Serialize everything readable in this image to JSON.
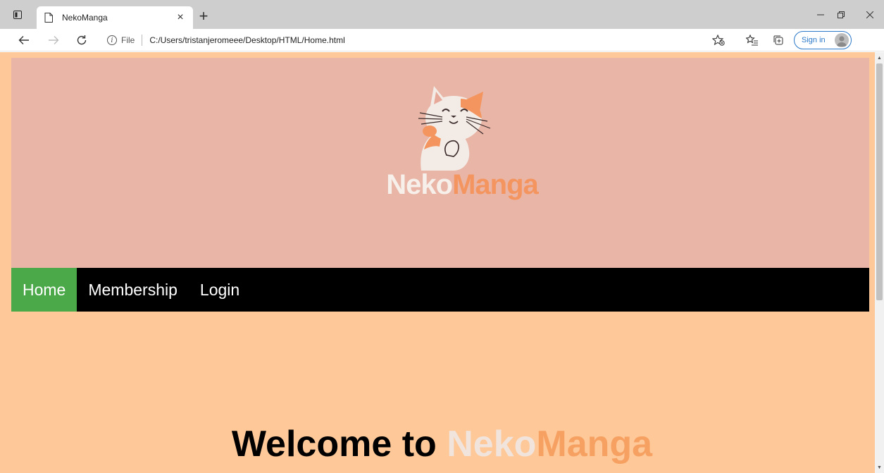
{
  "browser": {
    "tab_title": "NekoManga",
    "tab_close": "×",
    "new_tab": "+",
    "address_scheme": "File",
    "address_url": "C:/Users/tristanjeromeee/Desktop/HTML/Home.html",
    "signin_label": "Sign in",
    "more_label": "···",
    "icons": {
      "tab_actions": "tab-actions-icon",
      "page": "page-icon",
      "back": "back-arrow-icon",
      "forward": "forward-arrow-icon",
      "refresh": "refresh-icon",
      "info": "info-icon",
      "favorite": "add-favorite-icon",
      "favorites": "favorites-icon",
      "collections": "collections-icon",
      "minimize": "minimize-icon",
      "restore": "restore-icon",
      "close": "close-icon"
    }
  },
  "site": {
    "logo_neko": "Neko",
    "logo_manga": "Manga",
    "nav": [
      {
        "label": "Home",
        "active": true
      },
      {
        "label": "Membership",
        "active": false
      },
      {
        "label": "Login",
        "active": false
      }
    ],
    "welcome_prefix": "Welcome to ",
    "welcome_neko": "Neko",
    "welcome_manga": "Manga"
  },
  "colors": {
    "page_bg": "#fec898",
    "header_bg": "#e8b5a7",
    "nav_bg": "#000000",
    "nav_active": "#4ca94a",
    "logo_orange": "#f4955f",
    "logo_cream": "#f7efe9"
  }
}
